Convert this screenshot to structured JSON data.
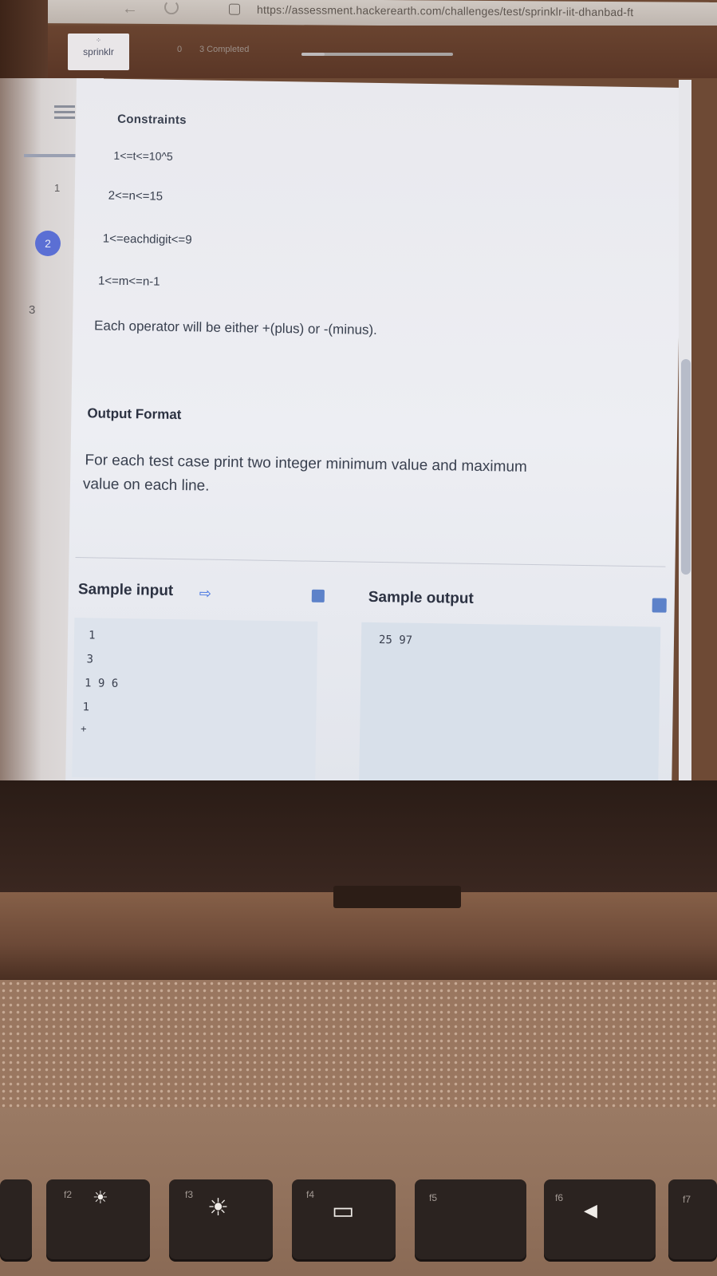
{
  "browser": {
    "url": "https://assessment.hackerearth.com/challenges/test/sprinklr-iit-dhanbad-ft"
  },
  "header": {
    "logo_text": "sprinklr",
    "logo_mark": "⁘",
    "progress_count": "0",
    "progress_label": "3 Completed",
    "progress_fraction": 0.15
  },
  "question_nav": {
    "items": [
      "1",
      "2",
      "3"
    ],
    "active": "2"
  },
  "content": {
    "constraints_heading": "Constraints",
    "constraints": [
      "1<=t<=10^5",
      "2<=n<=15",
      "1<=eachdigit<=9",
      "1<=m<=n-1",
      "Each operator will be either +(plus) or -(minus)."
    ],
    "output_format_heading": "Output Format",
    "output_format_line1": "For each test case print two integer minimum value and maximum",
    "output_format_line2": "value on each line.",
    "sample_input_heading": "Sample input",
    "sample_output_heading": "Sample output",
    "sample_input_lines": [
      "1",
      "3",
      "1 9 6",
      "1",
      "+"
    ],
    "sample_output_lines": [
      "25 97"
    ]
  },
  "keyboard": {
    "keys": [
      {
        "label": "f2",
        "icon": "☀"
      },
      {
        "label": "f3",
        "icon": "☀"
      },
      {
        "label": "f4",
        "icon": "▭"
      },
      {
        "label": "f5",
        "icon": ""
      },
      {
        "label": "f6",
        "icon": "◀"
      },
      {
        "label": "f7",
        "icon": ""
      }
    ]
  }
}
